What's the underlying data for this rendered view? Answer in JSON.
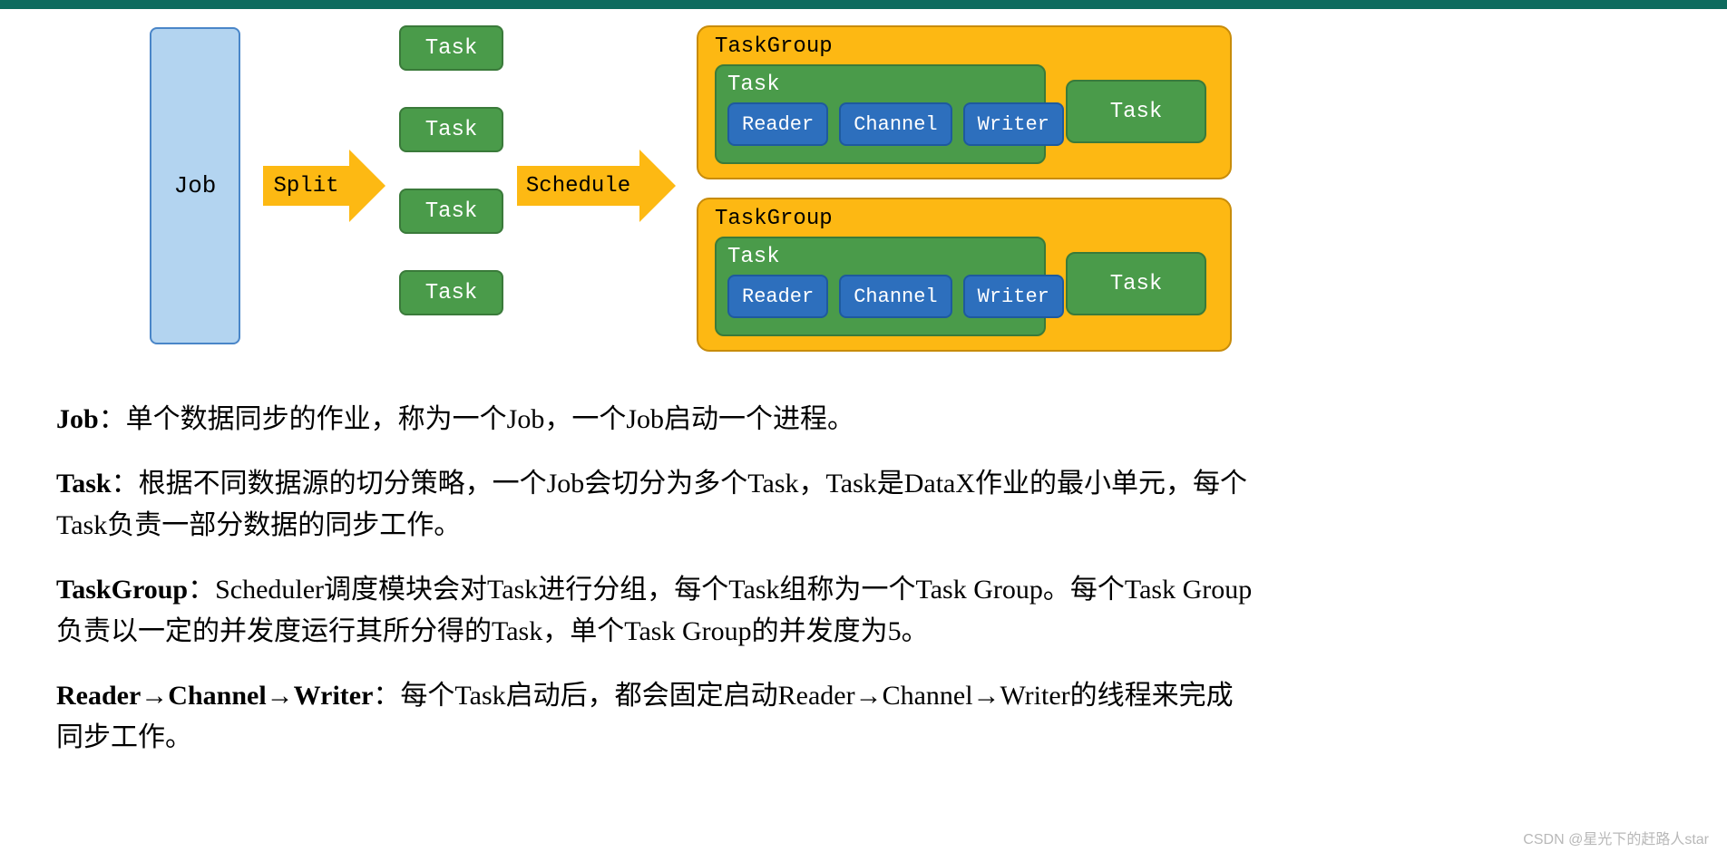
{
  "diagram": {
    "job_label": "Job",
    "arrow1_label": "Split",
    "arrow2_label": "Schedule",
    "tasks": [
      "Task",
      "Task",
      "Task",
      "Task"
    ],
    "taskgroups": [
      {
        "group_label": "TaskGroup",
        "expanded_task_label": "Task",
        "pipeline": [
          "Reader",
          "Channel",
          "Writer"
        ],
        "simple_task_label": "Task"
      },
      {
        "group_label": "TaskGroup",
        "expanded_task_label": "Task",
        "pipeline": [
          "Reader",
          "Channel",
          "Writer"
        ],
        "simple_task_label": "Task"
      }
    ]
  },
  "descriptions": {
    "p1_bold": "Job",
    "p1_text": "：单个数据同步的作业，称为一个Job，一个Job启动一个进程。",
    "p2_bold": "Task",
    "p2_text": "：根据不同数据源的切分策略，一个Job会切分为多个Task，Task是DataX作业的最小单元，每个Task负责一部分数据的同步工作。",
    "p3_bold": "TaskGroup",
    "p3_text": "：Scheduler调度模块会对Task进行分组，每个Task组称为一个Task Group。每个Task Group负责以一定的并发度运行其所分得的Task，单个Task Group的并发度为5。",
    "p4_bold": "Reader→Channel→Writer",
    "p4_text": "：每个Task启动后，都会固定启动Reader→Channel→Writer的线程来完成同步工作。"
  },
  "watermark": "CSDN @星光下的赶路人star"
}
